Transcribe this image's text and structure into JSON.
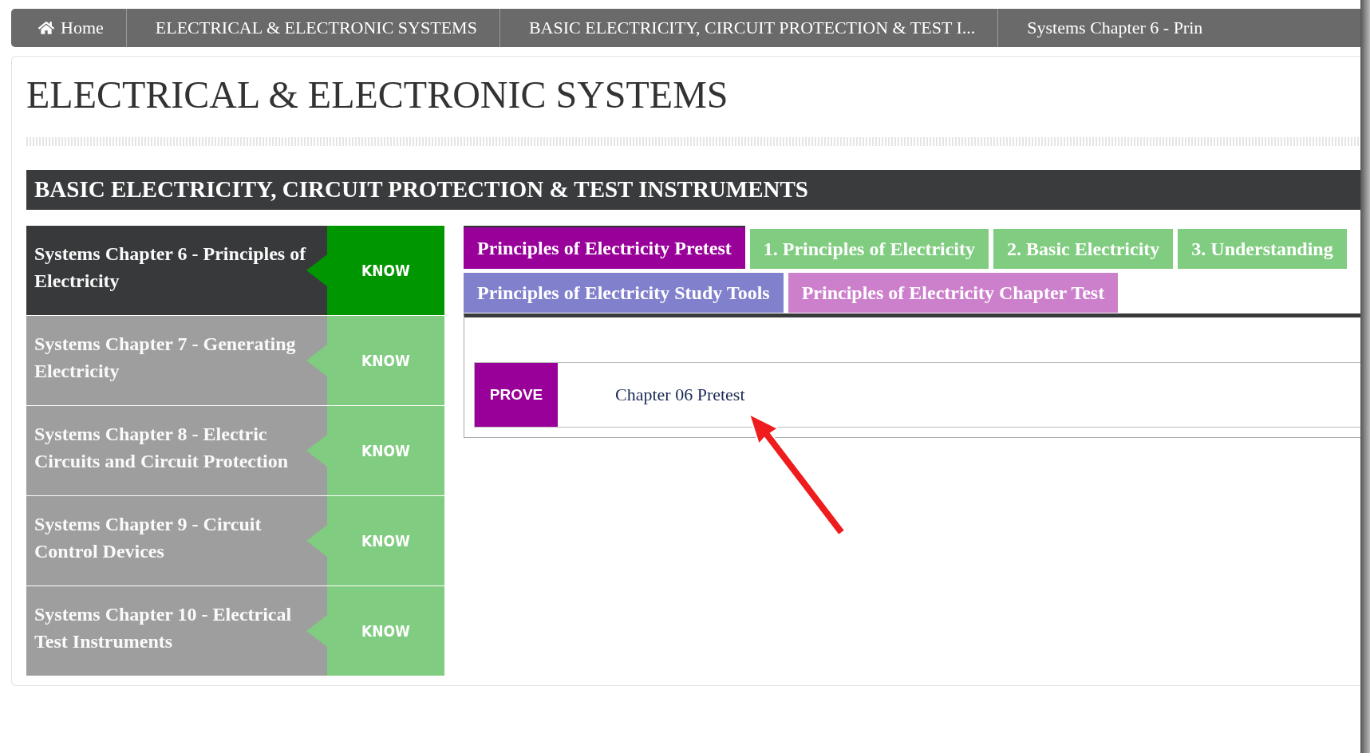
{
  "breadcrumb": [
    {
      "kind": "home",
      "label": "Home"
    },
    {
      "kind": "link",
      "label": "ELECTRICAL & ELECTRONIC SYSTEMS"
    },
    {
      "kind": "link",
      "label": "BASIC ELECTRICITY, CIRCUIT PROTECTION & TEST I..."
    },
    {
      "kind": "link",
      "label": "Systems Chapter 6 - Prin"
    }
  ],
  "title": "ELECTRICAL & ELECTRONIC SYSTEMS",
  "section_title": "BASIC ELECTRICITY, CIRCUIT PROTECTION & TEST INSTRUMENTS",
  "chapters": [
    {
      "title": "Systems Chapter 6 - Principles of Electricity",
      "badge": "KNOW",
      "selected": true
    },
    {
      "title": "Systems Chapter 7 - Generating Electricity",
      "badge": "KNOW",
      "selected": false
    },
    {
      "title": "Systems Chapter 8 - Electric Circuits and Circuit Protection",
      "badge": "KNOW",
      "selected": false
    },
    {
      "title": "Systems Chapter 9 - Circuit Control Devices",
      "badge": "KNOW",
      "selected": false
    },
    {
      "title": "Systems Chapter 10 - Electrical Test Instruments",
      "badge": "KNOW",
      "selected": false
    }
  ],
  "tab_rows": [
    [
      {
        "label": "Principles of Electricity Pretest",
        "color": "#990099",
        "selected": true
      },
      {
        "label": "1. Principles of Electricity",
        "color": "#80cc80",
        "selected": false
      },
      {
        "label": "2. Basic Electricity",
        "color": "#80cc80",
        "selected": false
      },
      {
        "label": "3. Understanding",
        "color": "#80cc80",
        "selected": false
      }
    ],
    [
      {
        "label": "Principles of Electricity Study Tools",
        "color": "#8080cc",
        "selected": false
      },
      {
        "label": "Principles of Electricity Chapter Test",
        "color": "#cc80cc",
        "selected": false
      }
    ]
  ],
  "items": [
    {
      "badge": "PROVE",
      "title": "Chapter 06 Pretest"
    }
  ]
}
